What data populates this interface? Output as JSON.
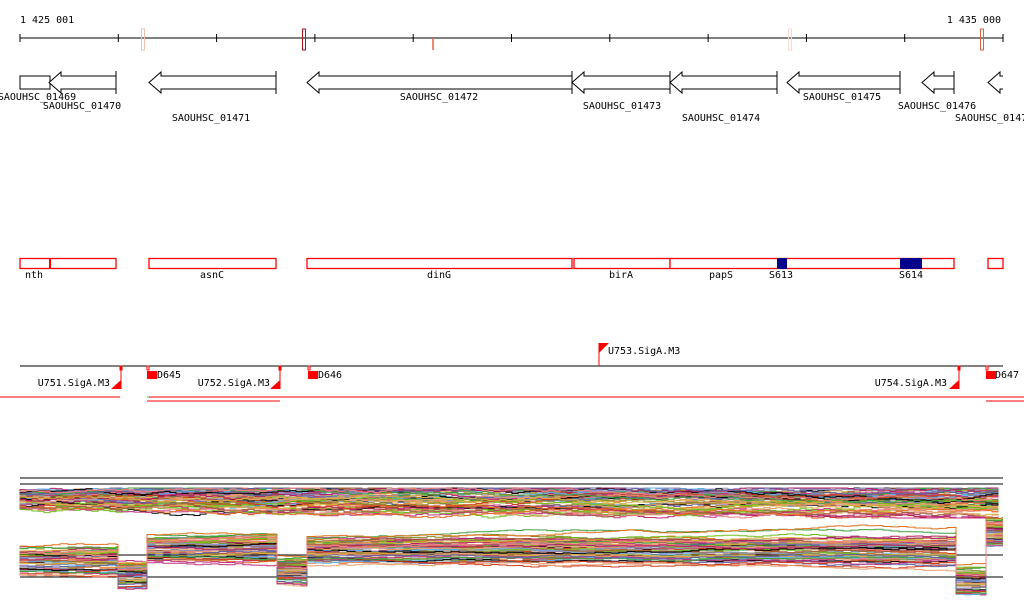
{
  "ruler": {
    "start_label": "1 425 001",
    "end_label": "1 435 000",
    "marks": [
      {
        "pos": 143,
        "color": "#f4c0b0",
        "style": "box"
      },
      {
        "pos": 304,
        "color": "#b01010",
        "style": "box"
      },
      {
        "pos": 433,
        "color": "#e86040",
        "style": "line"
      },
      {
        "pos": 790,
        "color": "#f8d8d0",
        "style": "box"
      },
      {
        "pos": 982,
        "color": "#e06040",
        "style": "box"
      }
    ]
  },
  "genes": [
    {
      "name": "SAOUHSC_01469",
      "strand": "box"
    },
    {
      "name": "SAOUHSC_01470",
      "strand": "-"
    },
    {
      "name": "SAOUHSC_01471",
      "strand": "-"
    },
    {
      "name": "SAOUHSC_01472",
      "strand": "-"
    },
    {
      "name": "SAOUHSC_01473",
      "strand": "-"
    },
    {
      "name": "SAOUHSC_01474",
      "strand": "-"
    },
    {
      "name": "SAOUHSC_01475",
      "strand": "-"
    },
    {
      "name": "SAOUHSC_01476",
      "strand": "-"
    },
    {
      "name": "SAOUHSC_0147",
      "strand": "-"
    }
  ],
  "operons": [
    {
      "label": "nth"
    },
    {
      "label": "asnC"
    },
    {
      "label": "dinG"
    },
    {
      "label": "birA"
    },
    {
      "label": "papS"
    },
    {
      "label": ""
    }
  ],
  "sites": [
    {
      "label": "S613",
      "color": "#00008b"
    },
    {
      "label": "S614",
      "color": "#00008b"
    }
  ],
  "promoters": [
    {
      "label": "U751.SigA.M3"
    },
    {
      "label": "D645"
    },
    {
      "label": "U752.SigA.M3"
    },
    {
      "label": "D646"
    },
    {
      "label": "U753.SigA.M3"
    },
    {
      "label": "U754.SigA.M3"
    },
    {
      "label": "D647"
    }
  ],
  "colors": {
    "feature": "#ff0000",
    "site": "#00008b",
    "expression_palette": [
      "#e07020",
      "#8a8a20",
      "#c03080",
      "#5fb0e8",
      "#70c020",
      "#d04020",
      "#a06040",
      "#9090c0",
      "#000000",
      "#e8a070",
      "#b02060",
      "#40a040",
      "#d8b040",
      "#6060a0",
      "#f08080"
    ]
  }
}
